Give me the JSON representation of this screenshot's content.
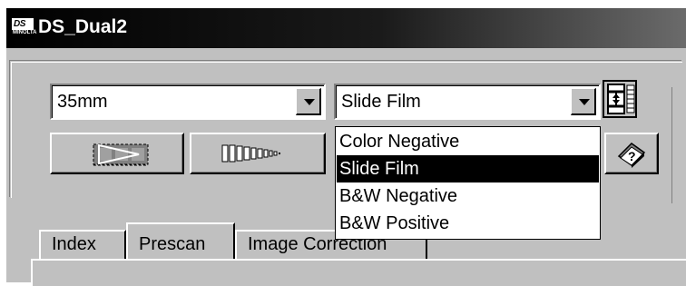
{
  "window": {
    "title": "DS_Dual2",
    "icon": "ds-app-icon",
    "icon_text": "DS",
    "icon_subtext": "MINOLTA"
  },
  "film_format": {
    "selected": "35mm"
  },
  "film_type": {
    "selected": "Slide Film",
    "options": [
      {
        "label": "Color Negative",
        "selected": false
      },
      {
        "label": "Slide Film",
        "selected": true
      },
      {
        "label": "B&W Negative",
        "selected": false
      },
      {
        "label": "B&W Positive",
        "selected": false
      }
    ]
  },
  "toolbar": {
    "buttons": [
      {
        "icon": "eject-film-icon"
      },
      {
        "icon": "film-strip-icon"
      },
      {
        "icon": "help-book-icon"
      }
    ],
    "side_icon": "film-holder-icon"
  },
  "tabs": [
    {
      "label": "Index",
      "active": false
    },
    {
      "label": "Prescan",
      "active": true
    },
    {
      "label": "Image Correction",
      "active": false
    }
  ]
}
